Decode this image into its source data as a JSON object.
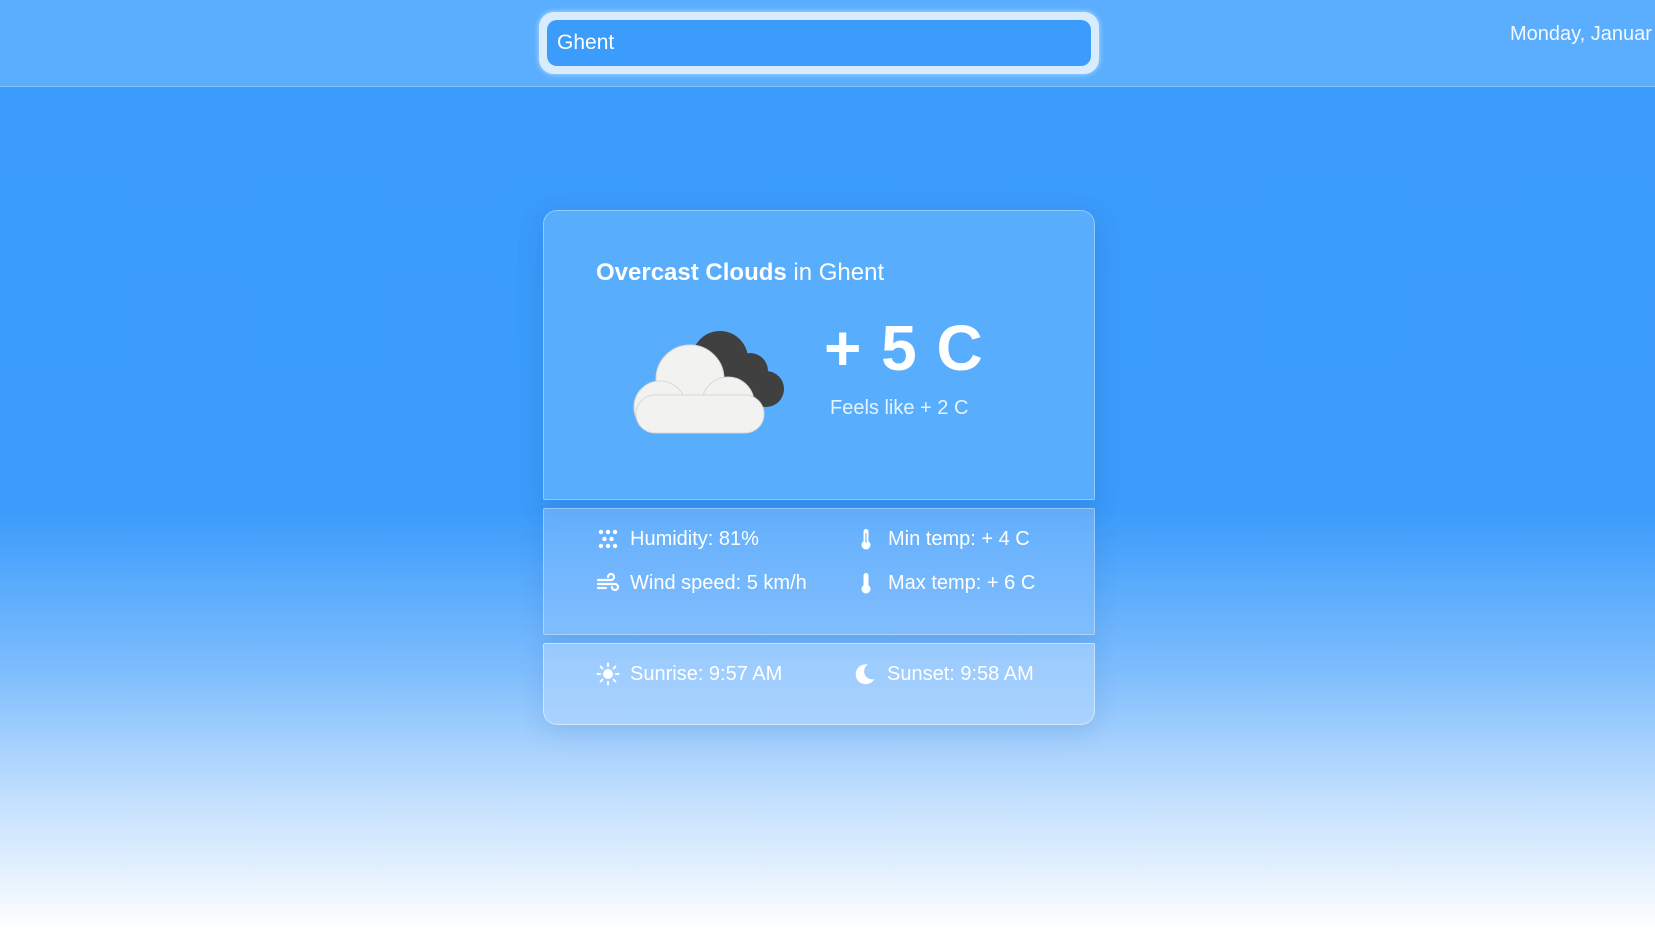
{
  "search": {
    "value": "Ghent"
  },
  "header": {
    "date": "Monday, Januar"
  },
  "weather": {
    "condition": "Overcast Clouds",
    "location_text": " in Ghent",
    "temperature": "+ 5 C",
    "feels_like": "Feels like + 2 C",
    "icon": "overcast-clouds-icon"
  },
  "stats": {
    "humidity": "Humidity: 81%",
    "wind_speed": "Wind speed: 5 km/h",
    "min_temp": "Min temp: + 4 C",
    "max_temp": "Max temp: + 6 C"
  },
  "sun": {
    "sunrise": "Sunrise: 9:57 AM",
    "sunset": "Sunset: 9:58 AM"
  },
  "colors": {
    "background_top": "#3a9bfc",
    "topbar": "#5aaefd",
    "card": "#58adfd",
    "text": "#ffffff",
    "cloud_front": "#f2f2f0",
    "cloud_back": "#404040"
  }
}
